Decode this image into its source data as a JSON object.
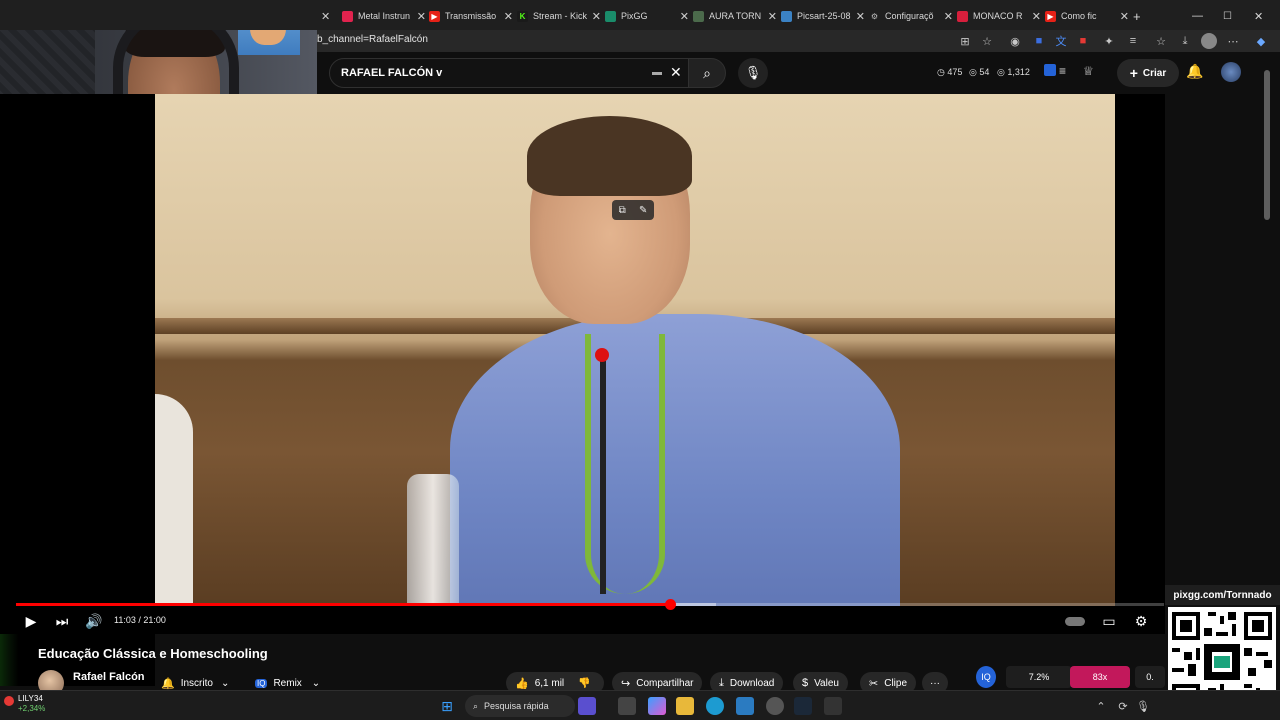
{
  "browser": {
    "tabs": [
      {
        "label": "",
        "favicon_color": "#2a2a2a",
        "icon": ""
      },
      {
        "label": "Metal Instrun",
        "favicon_color": "#e0234e",
        "icon": ""
      },
      {
        "label": "Transmissão",
        "favicon_color": "#e62117",
        "icon": "▶"
      },
      {
        "label": "Stream - Kick",
        "favicon_color": "#53fc18",
        "icon": "K"
      },
      {
        "label": "PixGG",
        "favicon_color": "#1a8c6a",
        "icon": ""
      },
      {
        "label": "AURA TORN",
        "favicon_color": "#4b6a4b",
        "icon": ""
      },
      {
        "label": "Picsart-25-08",
        "favicon_color": "#3b82c4",
        "icon": ""
      },
      {
        "label": "Configuraçõ",
        "favicon_color": "#666666",
        "icon": "⚙"
      },
      {
        "label": "MONACO R",
        "favicon_color": "#d61f3c",
        "icon": ""
      },
      {
        "label": "Como fic",
        "favicon_color": "#e62117",
        "icon": "▶"
      }
    ],
    "new_tab_label": "+",
    "url": "b_channel=RafaelFalcón"
  },
  "youtube": {
    "search_value": "RAFAEL FALCÓN v",
    "stats": {
      "views": "475",
      "likes": "54",
      "watchers": "1,312"
    },
    "create_label": "Criar"
  },
  "player": {
    "timecode": "11:03 / 21:00",
    "progress": 0.57,
    "buffered": 0.61
  },
  "video_info": {
    "title": "Educação Clássica e Homeschooling",
    "channel": "Rafael Falcón",
    "subscribed_label": "Inscrito",
    "remix_label": "Remix",
    "likes_label": "6,1 mil",
    "share_label": "Compartilhar",
    "download_label": "Download",
    "thanks_label": "Valeu",
    "clip_label": "Clipe",
    "more_label": "···"
  },
  "overlay": {
    "pixgg_url": "pixgg.com/Tornnado",
    "stat_percent": "7.2%",
    "stat_multiplier": "83x",
    "stat_partial": "0."
  },
  "taskbar": {
    "stock_name": "LILY34",
    "stock_change": "+2,34%",
    "search_placeholder": "Pesquisa rápida"
  },
  "colors": {
    "accent_red": "#ff0000",
    "pink_stat": "#c2185b",
    "dark_bg": "#0f0f0f"
  }
}
